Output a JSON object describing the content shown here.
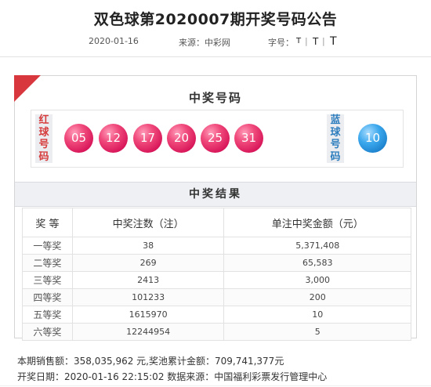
{
  "page": {
    "title": "双色球第2020007期开奖号码公告",
    "date": "2020-01-16",
    "source": "来源：中彩网",
    "size_label": "字号：",
    "size_options": [
      "T",
      "T",
      "T"
    ],
    "separator": "|"
  },
  "draw": {
    "title": "中奖号码",
    "red_label": "红球号码",
    "blue_label": "蓝球号码",
    "red_balls": [
      "05",
      "12",
      "17",
      "20",
      "25",
      "31"
    ],
    "blue_ball": "10",
    "colors": {
      "red": "#d8175a",
      "blue": "#1b7fcb",
      "accent": "#d8383d"
    }
  },
  "results": {
    "title": "中奖结果",
    "headers": [
      "奖 等",
      "中奖注数（注）",
      "单注中奖金额（元）"
    ],
    "rows": [
      {
        "grade": "一等奖",
        "count": "38",
        "amount": "5,371,408"
      },
      {
        "grade": "二等奖",
        "count": "269",
        "amount": "65,583"
      },
      {
        "grade": "三等奖",
        "count": "2413",
        "amount": "3,000"
      },
      {
        "grade": "四等奖",
        "count": "101233",
        "amount": "200"
      },
      {
        "grade": "五等奖",
        "count": "1615970",
        "amount": "10"
      },
      {
        "grade": "六等奖",
        "count": "12244954",
        "amount": "5"
      }
    ]
  },
  "footer": {
    "sales_line": "本期销售额：358,035,962 元,奖池累计金额：709,741,377元",
    "draw_line": "开奖日期：2020-01-16 22:15:02 数据来源：中国福利彩票发行管理中心"
  }
}
